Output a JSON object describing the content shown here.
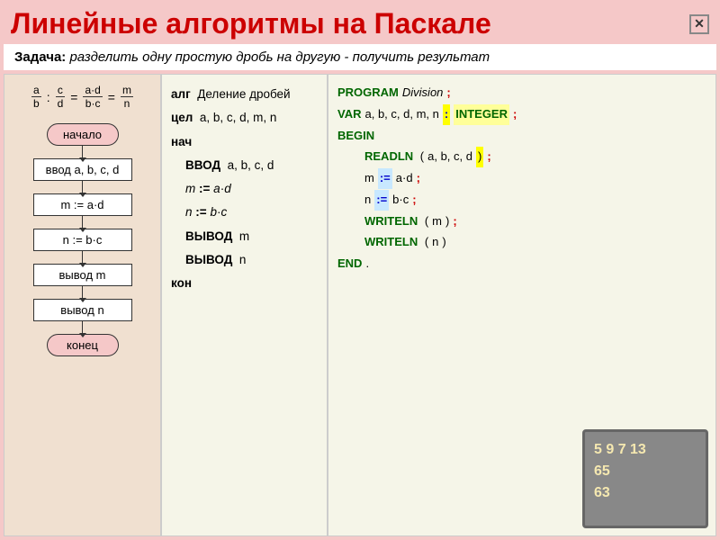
{
  "header": {
    "title": "Линейные алгоритмы на Паскале",
    "close_label": "✕"
  },
  "task": {
    "label": "Задача:",
    "text": " разделить одну простую дробь на другую - получить результат"
  },
  "formula": {
    "a": "a",
    "b": "b",
    "c": "c",
    "d": "d",
    "m": "m",
    "n": "n"
  },
  "flowchart": {
    "start": "начало",
    "input": "ввод a, b, c, d",
    "m_assign": "m := a·d",
    "n_assign": "n := b·c",
    "output_m": "вывод m",
    "output_n": "вывод n",
    "end": "конец"
  },
  "algorithm": {
    "alg": "алг",
    "title": "Деление дробей",
    "cel": "цел",
    "vars": "a, b, c, d, m, n",
    "nach": "нач",
    "vvod": "ВВОД",
    "vvod_vars": "a, b, c, d",
    "m_assign": "m := a·d",
    "n_assign": "n := b·c",
    "vyvod": "ВЫВОД",
    "vyvod_m": "m",
    "vyvod_n": "n",
    "kon": "кон"
  },
  "pascal": {
    "program": "PROGRAM",
    "division": "Division",
    "semi1": ";",
    "var": "VAR",
    "var_vars": "a, b, c, d, m, n",
    "colon": ":",
    "integer": "INTEGER",
    "semi2": ";",
    "begin": "BEGIN",
    "readln": "READLN",
    "readln_args": "a, b, c, d",
    "readln_semi": ";",
    "m_var": "m",
    "assign1": ":=",
    "m_expr": "a·d",
    "semi3": ";",
    "n_var": "n",
    "assign2": ":=",
    "n_expr": "b·c",
    "semi4": ";",
    "writeln1": "WRITELN",
    "writeln1_arg": "m",
    "writeln1_semi": ";",
    "writeln2": "WRITELN",
    "writeln2_arg": "n",
    "end": "END",
    "dot": "."
  },
  "monitor": {
    "line1": "5  9  7  13",
    "line2": "65",
    "line3": "63"
  }
}
